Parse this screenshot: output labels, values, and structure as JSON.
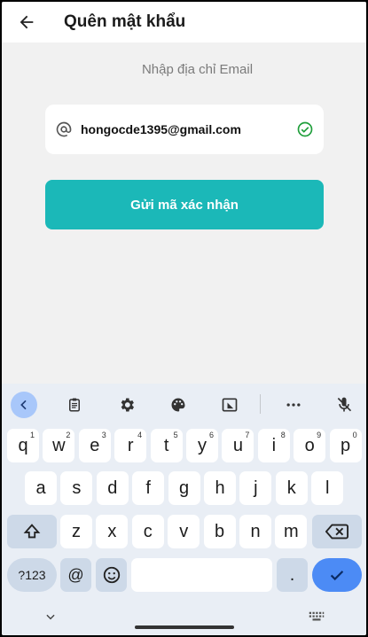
{
  "header": {
    "title": "Quên mật khẩu",
    "back_icon": "arrow-left-icon"
  },
  "form": {
    "prompt": "Nhập địa chỉ Email",
    "email_value": "hongocde1395@gmail.com",
    "submit_label": "Gửi mã xác nhận",
    "accent_color": "#1bb8b8",
    "valid_color": "#1e9e3a"
  },
  "keyboard": {
    "toolbar_icons": [
      "collapse-icon",
      "clipboard-icon",
      "gear-icon",
      "palette-icon",
      "resize-icon",
      "more-icon",
      "mic-off-icon"
    ],
    "row1": [
      {
        "k": "q",
        "h": "1"
      },
      {
        "k": "w",
        "h": "2"
      },
      {
        "k": "e",
        "h": "3"
      },
      {
        "k": "r",
        "h": "4"
      },
      {
        "k": "t",
        "h": "5"
      },
      {
        "k": "y",
        "h": "6"
      },
      {
        "k": "u",
        "h": "7"
      },
      {
        "k": "i",
        "h": "8"
      },
      {
        "k": "o",
        "h": "9"
      },
      {
        "k": "p",
        "h": "0"
      }
    ],
    "row2": [
      "a",
      "s",
      "d",
      "f",
      "g",
      "h",
      "j",
      "k",
      "l"
    ],
    "row3": [
      "z",
      "x",
      "c",
      "v",
      "b",
      "n",
      "m"
    ],
    "mode_label": "?123",
    "at_label": "@",
    "period_label": "."
  }
}
